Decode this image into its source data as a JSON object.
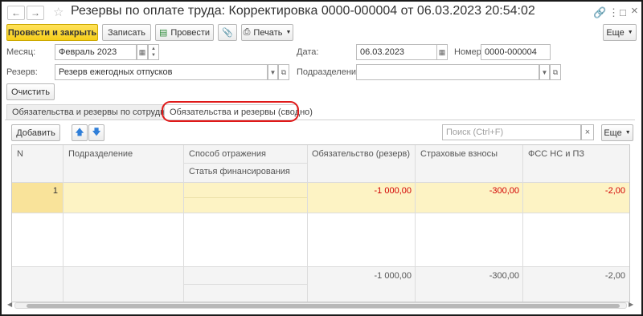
{
  "window": {
    "title": "Резервы по оплате труда: Корректировка 0000-000004 от 06.03.2023 20:54:02",
    "nav_back": "←",
    "nav_forward": "→",
    "star": "☆",
    "link_icon": "🔗",
    "more_icon": "⋮",
    "max_icon": "□",
    "close_icon": "×"
  },
  "toolbar": {
    "post_close": "Провести и закрыть",
    "save": "Записать",
    "post": "Провести",
    "print": "Печать",
    "more": "Еще"
  },
  "fields": {
    "month_label": "Месяц:",
    "month_value": "Февраль 2023",
    "date_label": "Дата:",
    "date_value": "06.03.2023",
    "number_label": "Номер:",
    "number_value": "0000-000004",
    "reserve_label": "Резерв:",
    "reserve_value": "Резерв ежегодных отпусков",
    "department_label": "Подразделение:",
    "department_value": ""
  },
  "clear_button": "Очистить",
  "tabs": [
    {
      "label": "Обязательства и резервы по сотрудникам"
    },
    {
      "label": "Обязательства и резервы (сводно)"
    }
  ],
  "table_toolbar": {
    "add": "Добавить",
    "search_placeholder": "Поиск (Ctrl+F)",
    "more": "Еще"
  },
  "table": {
    "headers": {
      "n": "N",
      "department": "Подразделение",
      "method": "Способ отражения",
      "article": "Статья финансирования",
      "liability": "Обязательство (резерв)",
      "insurance": "Страховые взносы",
      "fss": "ФСС НС и ПЗ"
    },
    "rows": [
      {
        "n": "1",
        "department": "",
        "method": "",
        "article": "",
        "liability": "-1 000,00",
        "insurance": "-300,00",
        "fss": "-2,00"
      }
    ],
    "totals": {
      "liability": "-1 000,00",
      "insurance": "-300,00",
      "fss": "-2,00"
    }
  },
  "colors": {
    "primary_button": "#f6cf1a",
    "selected_row": "#fdf3c4",
    "negative_value": "#d20000",
    "highlight": "#e01919"
  }
}
